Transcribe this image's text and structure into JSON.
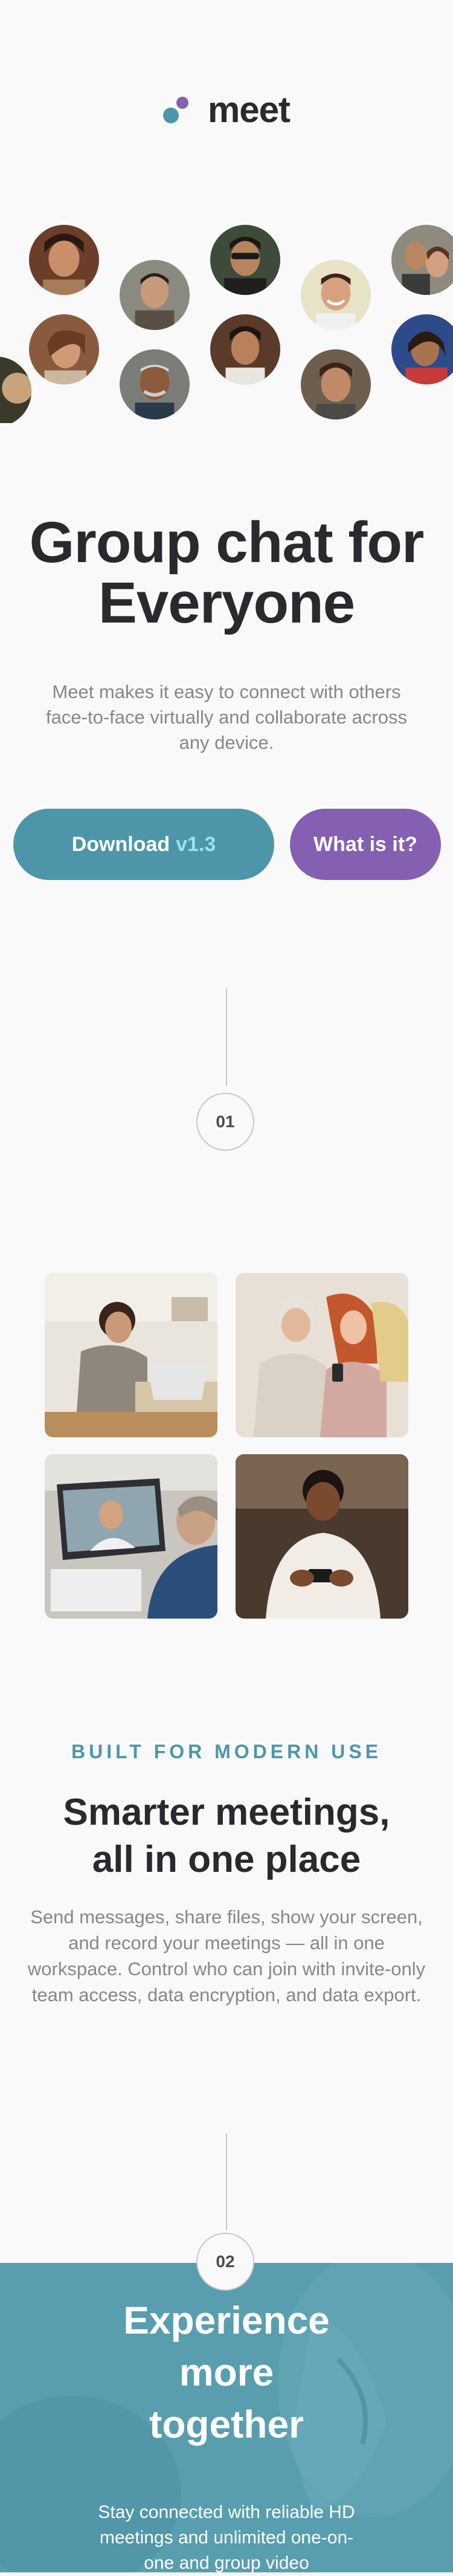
{
  "brand": {
    "name": "meet",
    "accent": "#4d96a9",
    "secondary": "#855fb1",
    "icon": "logo-dots-icon"
  },
  "hero": {
    "title_line1": "Group chat for",
    "title_line2": "Everyone",
    "description": "Meet makes it easy to connect with others face-to-face virtually and collaborate across any device.",
    "download_label": "Download",
    "download_version": "v1.3",
    "what_label": "What is it?"
  },
  "steps": {
    "first": "01",
    "second": "02"
  },
  "features": {
    "kicker": "BUILT FOR MODERN USE",
    "title_line1": "Smarter meetings,",
    "title_line2": "all in one place",
    "description": "Send messages, share files, show your screen, and record your meetings — all in one workspace. Control who can join with invite-only team access, data encryption, and data export."
  },
  "cta": {
    "title_line1": "Experience",
    "title_line2": "more",
    "title_line3": "together",
    "description": "Stay connected with reliable HD meetings and unlimited one-on-one and group video"
  }
}
